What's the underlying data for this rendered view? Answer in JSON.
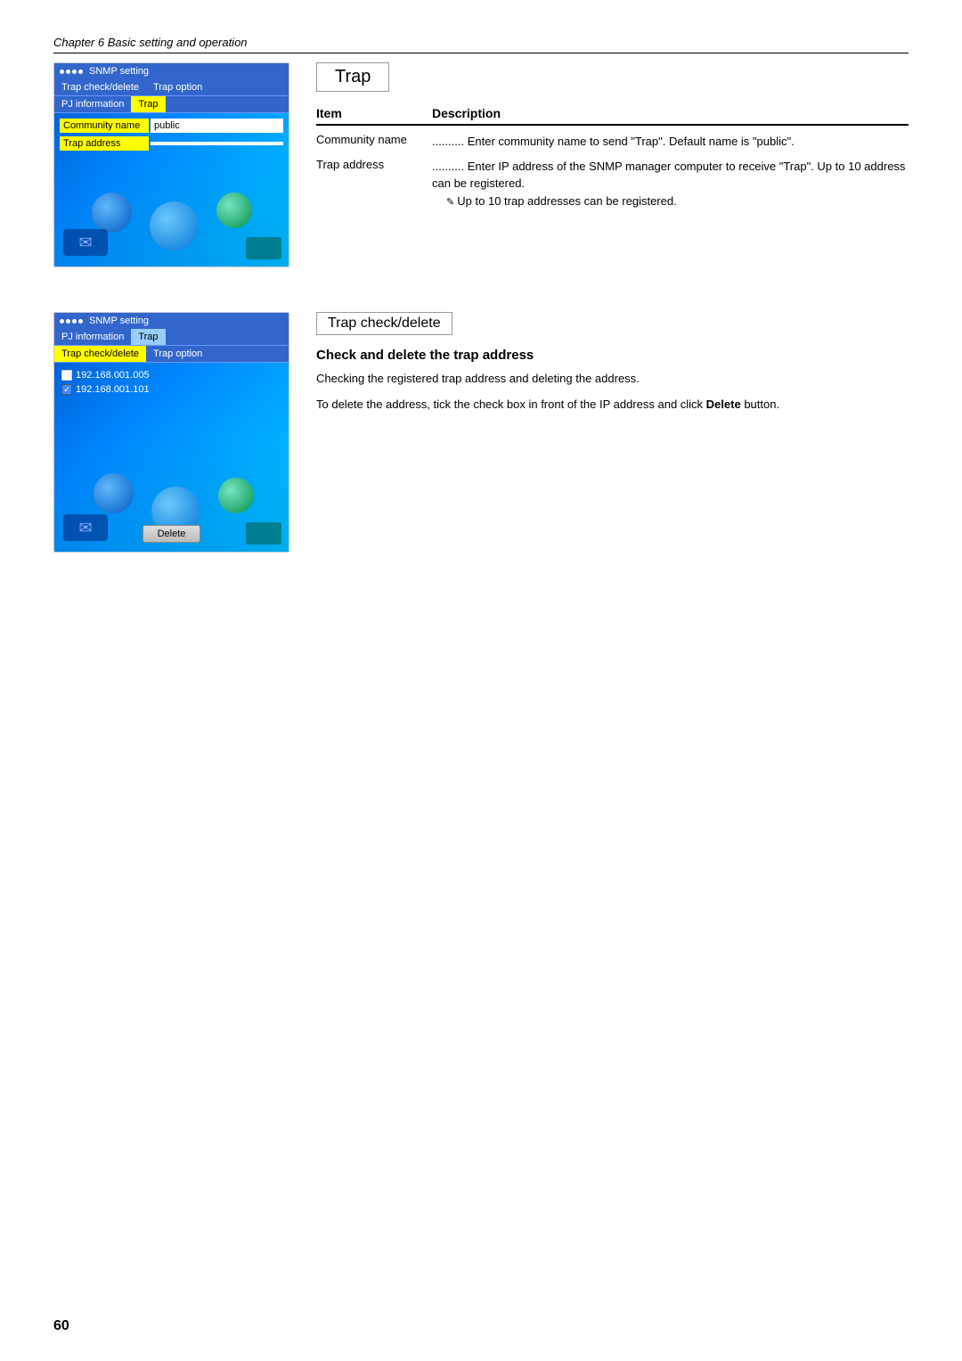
{
  "chapter_header": "Chapter 6 Basic setting and operation",
  "page_number": "60",
  "top_section": {
    "ui_panel": {
      "title": "SNMP setting",
      "nav": [
        {
          "label": "Trap check/delete",
          "state": "normal"
        },
        {
          "label": "Trap option",
          "state": "normal"
        }
      ],
      "nav2": [
        {
          "label": "PJ information",
          "state": "normal"
        },
        {
          "label": "Trap",
          "state": "active"
        }
      ],
      "rows": [
        {
          "label": "Community name",
          "value": "public",
          "label_style": "yellow"
        },
        {
          "label": "Trap address",
          "value": "",
          "label_style": "yellow"
        }
      ]
    },
    "content": {
      "title": "Trap",
      "table_headers": {
        "item": "Item",
        "description": "Description"
      },
      "rows": [
        {
          "item": "Community name",
          "dots": "..........",
          "description": "Enter community name to send \"Trap\". Default name is \"public\"."
        },
        {
          "item": "Trap address",
          "dots": "..........",
          "description": "Enter IP address of the SNMP manager computer to receive \"Trap\". Up to 10 address can be registered.",
          "note": "Up to 10 trap addresses can be registered."
        }
      ]
    }
  },
  "bottom_section": {
    "ui_panel": {
      "title": "SNMP setting",
      "nav1": [
        {
          "label": "PJ information",
          "state": "normal"
        },
        {
          "label": "Trap",
          "state": "selected"
        }
      ],
      "nav2": [
        {
          "label": "Trap check/delete",
          "state": "normal"
        },
        {
          "label": "Trap option",
          "state": "normal"
        }
      ],
      "checkboxes": [
        {
          "label": "192.168.001.005",
          "checked": false
        },
        {
          "label": "192.168.001.101",
          "checked": true
        }
      ],
      "delete_button": "Delete"
    },
    "content": {
      "title": "Trap check/delete",
      "subtitle": "Check and delete the trap address",
      "body1": "Checking the registered trap address and deleting the address.",
      "body2": "To delete the address, tick the check box in front of the IP address and click ",
      "body2_bold": "Delete",
      "body2_end": " button."
    }
  }
}
